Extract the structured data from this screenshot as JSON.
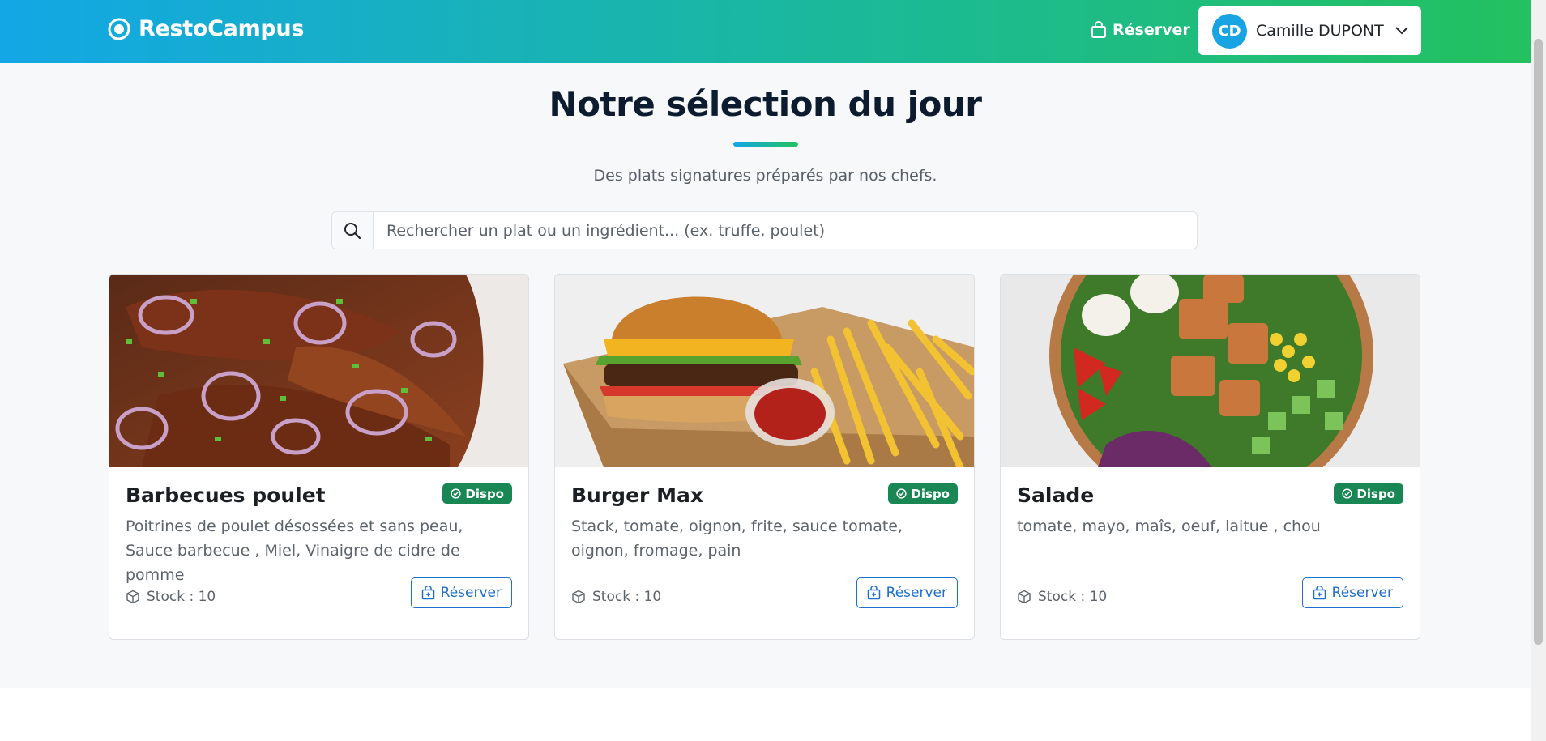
{
  "brand": {
    "name": "RestoCampus",
    "icon": "logo-icon"
  },
  "nav": {
    "reserve_label": "Réserver",
    "user": {
      "initials": "CD",
      "name": "Camille DUPONT"
    }
  },
  "header": {
    "title": "Notre sélection du jour",
    "subtitle": "Des plats signatures préparés par nos chefs."
  },
  "search": {
    "placeholder": "Rechercher un plat ou un ingrédient... (ex. truffe, poulet)",
    "value": ""
  },
  "dishes": [
    {
      "title": "Barbecues poulet",
      "badge": "Dispo",
      "description": "Poitrines de poulet désossées et sans peau, Sauce barbecue , Miel, Vinaigre de cidre de pomme",
      "stock": "Stock : 10",
      "button": "Réserver"
    },
    {
      "title": "Burger Max",
      "badge": "Dispo",
      "description": "Stack, tomate, oignon, frite, sauce tomate, oignon, fromage, pain",
      "stock": "Stock : 10",
      "button": "Réserver"
    },
    {
      "title": "Salade",
      "badge": "Dispo",
      "description": "tomate, mayo, maîs, oeuf, laitue , chou",
      "stock": "Stock : 10",
      "button": "Réserver"
    }
  ],
  "colors": {
    "gradient_start": "#13a7e6",
    "gradient_end": "#23c15f",
    "badge": "#198754",
    "primary": "#1f6fd0"
  }
}
